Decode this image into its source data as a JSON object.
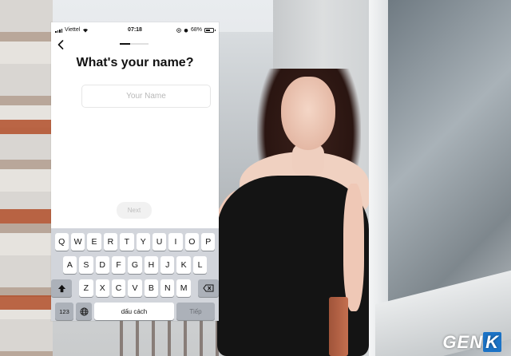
{
  "status_bar": {
    "carrier": "Viettel",
    "time": "07:18",
    "battery_percent": "68%",
    "battery_level": 0.68
  },
  "screen": {
    "progress": 0.35,
    "title": "What's your name?",
    "name_input": {
      "placeholder": "Your Name",
      "value": ""
    },
    "next_label": "Next"
  },
  "keyboard": {
    "row1": [
      "Q",
      "W",
      "E",
      "R",
      "T",
      "Y",
      "U",
      "I",
      "O",
      "P"
    ],
    "row2": [
      "A",
      "S",
      "D",
      "F",
      "G",
      "H",
      "J",
      "K",
      "L"
    ],
    "row3": [
      "Z",
      "X",
      "C",
      "V",
      "B",
      "N",
      "M"
    ],
    "numbers_label": "123",
    "space_label": "dấu cách",
    "return_label": "Tiếp"
  },
  "watermark": {
    "prefix": "GEN",
    "suffix": "K"
  },
  "colors": {
    "keyboard_bg": "#d2d5db",
    "text": "#111111",
    "placeholder": "#b8b8b8"
  },
  "icons": [
    "back-chevron-icon",
    "signal-icon",
    "wifi-icon",
    "battery-icon",
    "shift-icon",
    "backspace-icon",
    "globe-icon",
    "alarm-icon",
    "location-icon"
  ]
}
